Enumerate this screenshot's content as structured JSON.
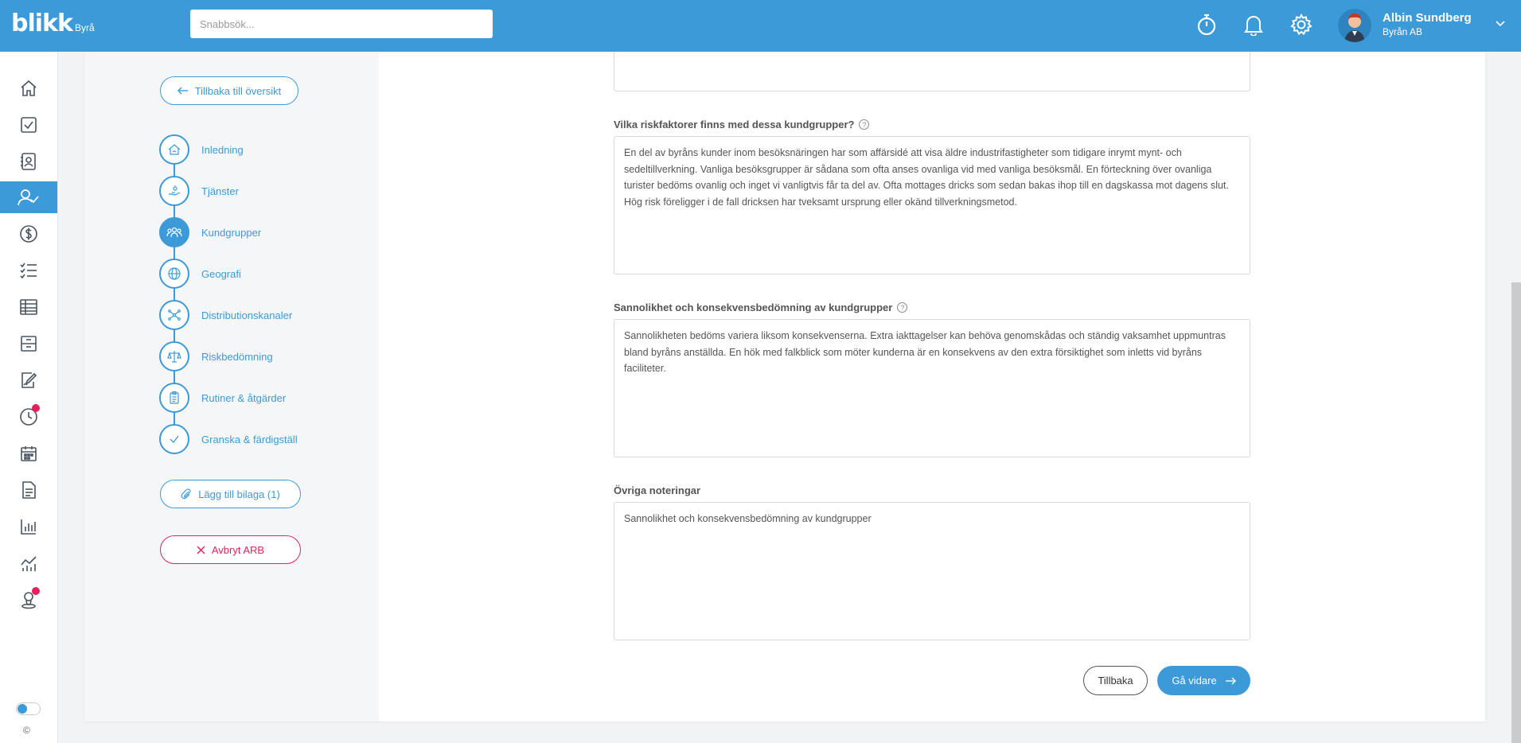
{
  "app": {
    "logo_main": "blikk",
    "logo_sub": "Byrå"
  },
  "search": {
    "placeholder": "Snabbsök..."
  },
  "header": {
    "icons": [
      "stopwatch-icon",
      "bell-icon",
      "gear-icon"
    ],
    "user_name": "Albin Sundberg",
    "user_org": "Byrån AB"
  },
  "colors": {
    "accent": "#3d9ad9",
    "danger": "#e0245e",
    "badge": "#e0245e"
  },
  "leftnav": {
    "items": [
      "home-icon",
      "checkbox-icon",
      "contacts-icon",
      "user-check-icon",
      "dollar-icon",
      "checklist-icon",
      "table-icon",
      "archive-icon",
      "signature-icon",
      "clock-icon",
      "calendar-icon",
      "document-icon",
      "bar-chart-icon",
      "line-chart-icon",
      "support-icon"
    ],
    "active_index": 3,
    "badged": [
      "clock-icon",
      "support-icon"
    ],
    "copyright": "©"
  },
  "steps_panel": {
    "back_label": "Tillbaka till översikt",
    "steps": [
      {
        "label": "Inledning",
        "icon": "house-icon"
      },
      {
        "label": "Tjänster",
        "icon": "hand-icon"
      },
      {
        "label": "Kundgrupper",
        "icon": "people-icon"
      },
      {
        "label": "Geografi",
        "icon": "globe-icon"
      },
      {
        "label": "Distributionskanaler",
        "icon": "network-icon"
      },
      {
        "label": "Riskbedömning",
        "icon": "scale-icon"
      },
      {
        "label": "Rutiner & åtgärder",
        "icon": "clipboard-icon"
      },
      {
        "label": "Granska & färdigställ",
        "icon": "check-icon"
      }
    ],
    "active_step": 2,
    "attach_label": "Lägg till bilaga (1)",
    "cancel_label": "Avbryt ARB"
  },
  "form": {
    "q1_label": "Vilka riskfaktorer finns med dessa kundgrupper?",
    "q1_value": "En del av byråns kunder inom besöksnäringen har som affärsidé att visa äldre industrifastigheter som tidigare inrymt mynt- och sedeltillverkning. Vanliga besöksgrupper är sådana som ofta anses ovanliga vid med vanliga besöksmål. En förteckning över ovanliga turister bedöms ovanlig och inget vi vanligtvis får ta del av. Ofta mottages dricks som sedan bakas ihop till en dagskassa mot dagens slut. Hög risk föreligger i de fall dricksen har tveksamt ursprung eller okänd tillverkningsmetod.",
    "q2_label": "Sannolikhet och konsekvensbedömning av kundgrupper",
    "q2_value": "Sannolikheten bedöms variera liksom konsekvenserna. Extra iakttagelser kan behöva genomskådas och ständig vaksamhet uppmuntras bland byråns anställda. En hök med falkblick som möter kunderna är en konsekvens av den extra försiktighet som inletts vid byråns faciliteter.",
    "q3_label": "Övriga noteringar",
    "q3_value": "Sannolikhet och konsekvensbedömning av kundgrupper",
    "help_glyph": "?",
    "back_button": "Tillbaka",
    "next_button": "Gå vidare"
  }
}
